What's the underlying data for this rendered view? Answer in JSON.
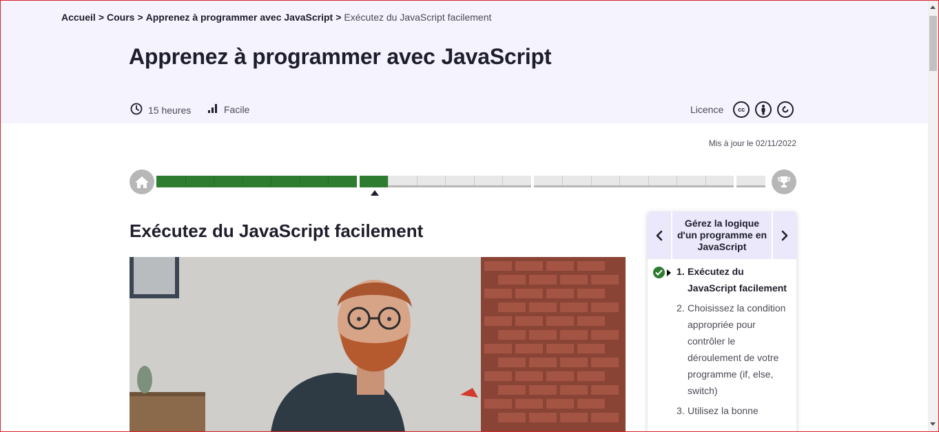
{
  "breadcrumb": {
    "items": [
      "Accueil",
      "Cours",
      "Apprenez à programmer avec JavaScript"
    ],
    "separator": ">",
    "current": "Exécutez du JavaScript facilement"
  },
  "course": {
    "title": "Apprenez à programmer avec JavaScript",
    "duration": "15 heures",
    "level": "Facile",
    "licence_label": "Licence",
    "licence_icons": [
      "cc-icon",
      "by-attribution-icon",
      "sa-share-alike-icon"
    ],
    "cc_text": "cc",
    "updated": "Mis à jour le 02/11/2022"
  },
  "progress": {
    "parts": [
      {
        "chapters": 7,
        "completed": 7
      },
      {
        "chapters": 6,
        "completed": 1
      },
      {
        "chapters": 7,
        "completed": 0
      },
      {
        "chapters": 1,
        "completed": 0
      }
    ],
    "current_part": 2,
    "current_chapter": 1
  },
  "chapter": {
    "title": "Exécutez du JavaScript facilement"
  },
  "sidebar": {
    "part_title": "Gérez la logique d'un programme en JavaScript",
    "items": [
      {
        "num": "1.",
        "label": "Exécutez du JavaScript facilement",
        "active": true,
        "done": true
      },
      {
        "num": "2.",
        "label": "Choisissez la condition appropriée pour contrôler le déroulement de votre programme (if, else, switch)",
        "active": false,
        "done": false
      },
      {
        "num": "3.",
        "label": "Utilisez la bonne",
        "active": false,
        "done": false
      }
    ]
  },
  "colors": {
    "accent_green": "#2d7c2f",
    "hero_bg": "#f4f3fe",
    "text": "#1d1d2b"
  }
}
